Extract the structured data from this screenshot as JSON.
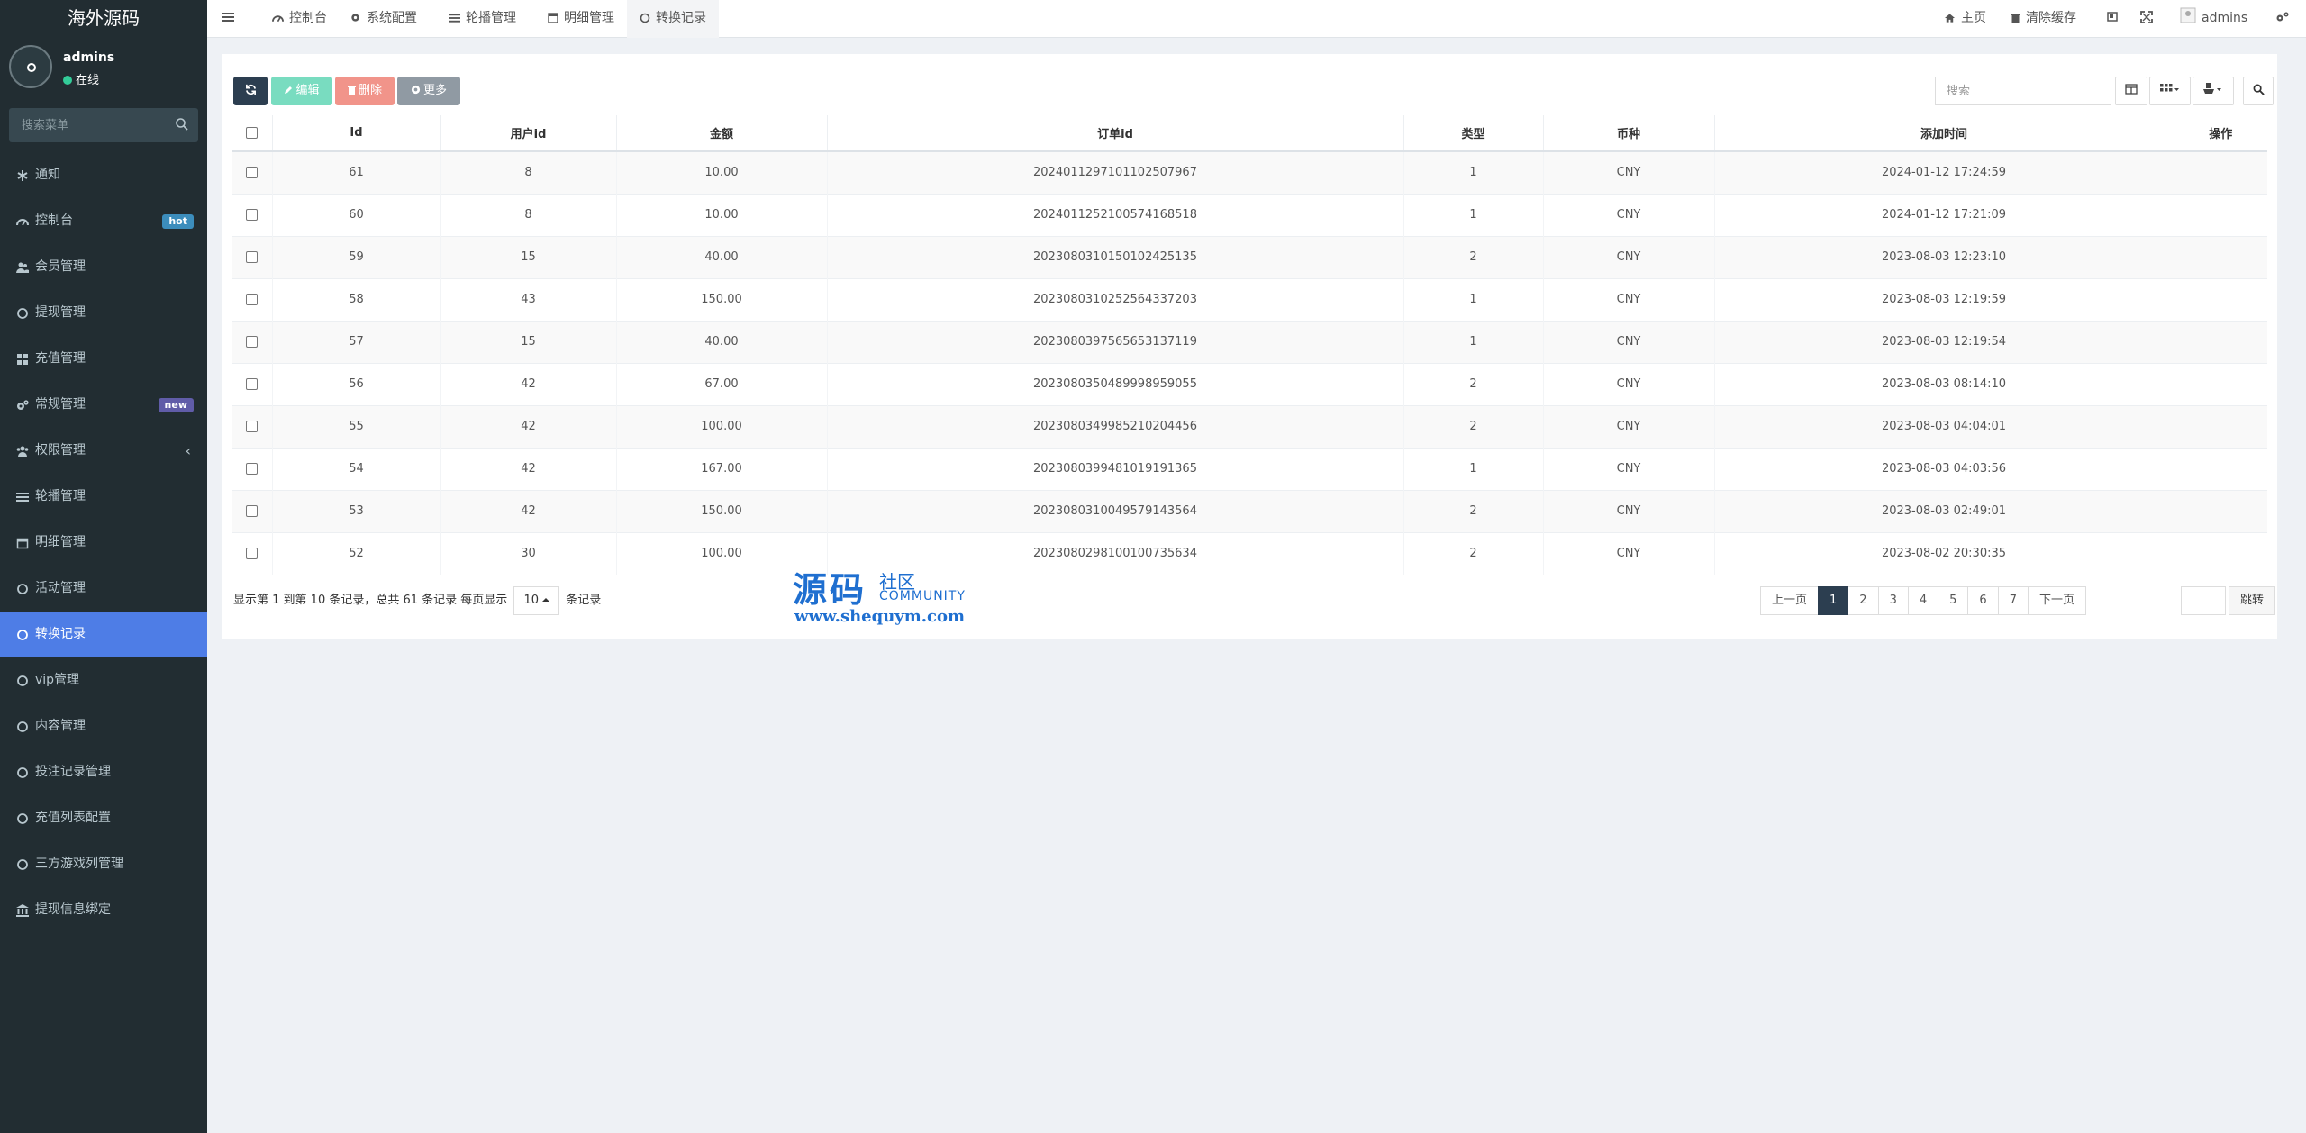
{
  "app": {
    "brand": "海外源码"
  },
  "user": {
    "name": "admins",
    "status": "在线"
  },
  "menu_search": {
    "placeholder": "搜索菜单"
  },
  "menu": [
    {
      "label": "通知",
      "icon": "asterisk-icon"
    },
    {
      "label": "控制台",
      "icon": "dashboard-icon",
      "badge": "hot"
    },
    {
      "label": "会员管理",
      "icon": "users-icon"
    },
    {
      "label": "提现管理",
      "icon": "circle-icon"
    },
    {
      "label": "充值管理",
      "icon": "grid-icon"
    },
    {
      "label": "常规管理",
      "icon": "cogs-icon",
      "badge": "new"
    },
    {
      "label": "权限管理",
      "icon": "group-icon"
    },
    {
      "label": "轮播管理",
      "icon": "list-icon"
    },
    {
      "label": "明细管理",
      "icon": "calendar-icon"
    },
    {
      "label": "活动管理",
      "icon": "circle-icon"
    },
    {
      "label": "转换记录",
      "icon": "circle-icon",
      "active": true
    },
    {
      "label": "vip管理",
      "icon": "circle-icon"
    },
    {
      "label": "内容管理",
      "icon": "circle-icon"
    },
    {
      "label": "投注记录管理",
      "icon": "circle-icon"
    },
    {
      "label": "充值列表配置",
      "icon": "circle-icon"
    },
    {
      "label": "三方游戏列管理",
      "icon": "circle-icon"
    },
    {
      "label": "提现信息绑定",
      "icon": "bank-icon"
    }
  ],
  "tabs": [
    {
      "label": "控制台"
    },
    {
      "label": "系统配置"
    },
    {
      "label": "轮播管理"
    },
    {
      "label": "明细管理"
    },
    {
      "label": "转换记录"
    }
  ],
  "topbar_right": {
    "home": "主页",
    "clear_cache": "清除缓存",
    "user": "admins"
  },
  "toolbar": {
    "edit": "编辑",
    "delete": "删除",
    "more": "更多",
    "search_placeholder": "搜索"
  },
  "table": {
    "columns": [
      "Id",
      "用户id",
      "金额",
      "订单id",
      "类型",
      "币种",
      "添加时间",
      "操作"
    ],
    "rows": [
      [
        "61",
        "8",
        "10.00",
        "20240112971011025079​67",
        "1",
        "CNY",
        "2024-01-12 17:24:59",
        ""
      ],
      [
        "60",
        "8",
        "10.00",
        "2024011252100574168518",
        "1",
        "CNY",
        "2024-01-12 17:21:09",
        ""
      ],
      [
        "59",
        "15",
        "40.00",
        "2023080310150102425135",
        "2",
        "CNY",
        "2023-08-03 12:23:10",
        ""
      ],
      [
        "58",
        "43",
        "150.00",
        "2023080310252564337203",
        "1",
        "CNY",
        "2023-08-03 12:19:59",
        ""
      ],
      [
        "57",
        "15",
        "40.00",
        "2023080397565653137119",
        "1",
        "CNY",
        "2023-08-03 12:19:54",
        ""
      ],
      [
        "56",
        "42",
        "67.00",
        "2023080350489998959055",
        "2",
        "CNY",
        "2023-08-03 08:14:10",
        ""
      ],
      [
        "55",
        "42",
        "100.00",
        "2023080349985210204456",
        "2",
        "CNY",
        "2023-08-03 04:04:01",
        ""
      ],
      [
        "54",
        "42",
        "167.00",
        "2023080399481019191365",
        "1",
        "CNY",
        "2023-08-03 04:03:56",
        ""
      ],
      [
        "53",
        "42",
        "150.00",
        "2023080310049579143564",
        "2",
        "CNY",
        "2023-08-03 02:49:01",
        ""
      ],
      [
        "52",
        "30",
        "100.00",
        "2023080298100100735634",
        "2",
        "CNY",
        "2023-08-02 20:30:35",
        ""
      ]
    ]
  },
  "pagination": {
    "info_prefix": "显示第 1 到第 10 条记录，总共 61 条记录 每页显示",
    "page_size": "10",
    "info_suffix": "条记录",
    "prev": "上一页",
    "pages": [
      "1",
      "2",
      "3",
      "4",
      "5",
      "6",
      "7"
    ],
    "current": "1",
    "next": "下一页",
    "jump": "跳转"
  },
  "watermark": {
    "logo": "源码",
    "small": "社区",
    "community": "COMMUNITY",
    "url": "www.shequym.com"
  },
  "colors": {
    "sidebar": "#222d32",
    "active": "#4e7de6",
    "primary": "#2c3e50",
    "success": "#79dcc0",
    "danger": "#f1948a",
    "info": "#909aa3"
  }
}
